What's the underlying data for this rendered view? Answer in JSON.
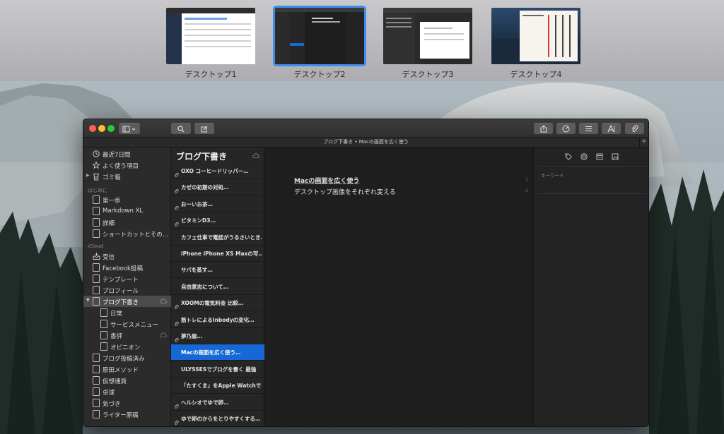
{
  "spaces": [
    {
      "label": "デスクトップ1",
      "active": false
    },
    {
      "label": "デスクトップ2",
      "active": true
    },
    {
      "label": "デスクトップ3",
      "active": false
    },
    {
      "label": "デスクトップ4",
      "active": false
    }
  ],
  "window": {
    "title": "ブログ下書き • Macの画面を広く使う"
  },
  "toolbar": {
    "icons": [
      "sidebar-toggle-icon",
      "search-icon",
      "compose-icon",
      "share-icon",
      "dashboard-icon",
      "list-icon",
      "typography-icon",
      "attachment-icon"
    ]
  },
  "library": {
    "top_items": [
      {
        "label": "最近7日間",
        "icon": "clock-icon"
      },
      {
        "label": "よく使う項目",
        "icon": "star-icon"
      },
      {
        "label": "ゴミ箱",
        "icon": "trash-icon"
      }
    ],
    "section_start": "はじめに",
    "start_items": [
      {
        "label": "第一歩"
      },
      {
        "label": "Markdown XL"
      },
      {
        "label": "詳細"
      },
      {
        "label": "ショートカットとその…"
      }
    ],
    "section_icloud": "iCloud",
    "icloud_items": [
      {
        "label": "受信",
        "icon": "inbox-icon"
      },
      {
        "label": "Facebook投稿"
      },
      {
        "label": "テンプレート"
      },
      {
        "label": "プロフィール"
      },
      {
        "label": "ブログ下書き",
        "selected": true
      },
      {
        "label": "日常",
        "child": true
      },
      {
        "label": "サービスメニュー",
        "child": true
      },
      {
        "label": "書評",
        "child": true
      },
      {
        "label": "オピニオン",
        "child": true
      },
      {
        "label": "ブログ投稿済み"
      },
      {
        "label": "原田メソッド"
      },
      {
        "label": "仮想通貨"
      },
      {
        "label": "卓球"
      },
      {
        "label": "気づき"
      },
      {
        "label": "ライター原稿"
      }
    ]
  },
  "sheets": {
    "title": "ブログ下書き",
    "items": [
      {
        "text": "OXO コーヒードリッパー…",
        "clip": true
      },
      {
        "text": "カゼの初期の対処…",
        "clip": true
      },
      {
        "text": "おーいお茶…",
        "clip": true
      },
      {
        "text": "ビタミンD3…",
        "clip": true
      },
      {
        "text": "カフェ仕事で電話がうるさいとき…",
        "clip": false
      },
      {
        "text": "iPhone iPhone XS Maxの写…",
        "clip": false
      },
      {
        "text": "サバを蒸す…",
        "clip": false
      },
      {
        "text": "自由意志について…",
        "clip": false
      },
      {
        "text": "XOOMの電気料金 比較…",
        "clip": true
      },
      {
        "text": "筋トレによるInbodyの変化…",
        "clip": true
      },
      {
        "text": "夢乃屋…",
        "clip": true
      },
      {
        "text": "Macの画面を広く使う…",
        "clip": false,
        "selected": true
      },
      {
        "text": "ULYSSESでブログを書く 最強",
        "clip": false
      },
      {
        "text": "「たすくま」をApple Watchで…",
        "clip": false
      },
      {
        "text": "ヘルシオでゆで卵…",
        "clip": true
      },
      {
        "text": "ゆで卵のからをとりやすくする…",
        "clip": true
      }
    ]
  },
  "editor": {
    "lines": [
      {
        "text": "Macの画面を広く使う",
        "num": "1"
      },
      {
        "text": "デスクトップ画像をそれぞれ変える",
        "num": "2"
      }
    ]
  },
  "attachments": {
    "keywords_label": "キーワード",
    "icons": [
      "tag-icon",
      "goal-icon",
      "note-icon",
      "image-icon"
    ]
  }
}
